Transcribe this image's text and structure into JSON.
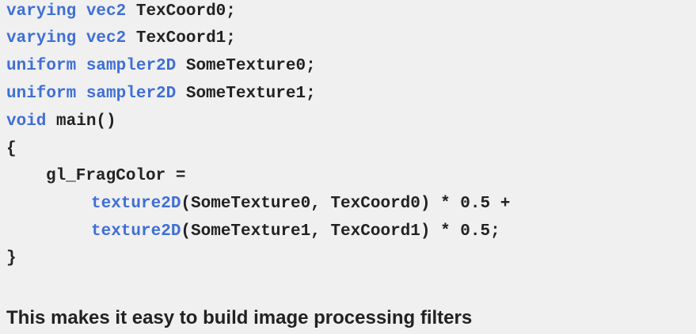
{
  "colors": {
    "background": "#f0f0f0",
    "text": "#222222",
    "keyword": "#3f6fd6"
  },
  "code": {
    "line1": {
      "kw1": "varying",
      "kw2": "vec2",
      "rest": " TexCoord0;"
    },
    "line2": {
      "kw1": "varying",
      "kw2": "vec2",
      "rest": " TexCoord1;"
    },
    "line3": {
      "kw1": "uniform",
      "kw2": "sampler2D",
      "rest": " SomeTexture0;"
    },
    "line4": {
      "kw1": "uniform",
      "kw2": "sampler2D",
      "rest": " SomeTexture1;"
    },
    "line5": {
      "kw1": "void",
      "rest": " main()"
    },
    "line6": {
      "text": "{"
    },
    "line7": {
      "text": "gl_FragColor ="
    },
    "line8": {
      "fn": "texture2D",
      "rest": "(SomeTexture0, TexCoord0) * 0.5 +"
    },
    "line9": {
      "fn": "texture2D",
      "rest": "(SomeTexture1, TexCoord1) * 0.5;"
    },
    "line10": {
      "text": "}"
    }
  },
  "caption": "This makes it easy to build image processing filters"
}
